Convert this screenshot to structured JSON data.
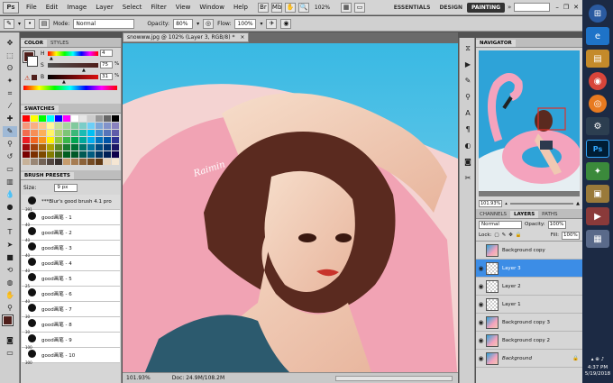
{
  "menubar": {
    "logo": "Ps",
    "items": [
      "File",
      "Edit",
      "Image",
      "Layer",
      "Select",
      "Filter",
      "View",
      "Window",
      "Help"
    ],
    "zoom": "102%",
    "workspaces": [
      "ESSENTIALS",
      "DESIGN",
      "PAINTING"
    ],
    "active_workspace": "PAINTING"
  },
  "options": {
    "mode_label": "Mode:",
    "mode_value": "Normal",
    "opacity_label": "Opacity:",
    "opacity_value": "80%",
    "flow_label": "Flow:",
    "flow_value": "100%"
  },
  "document": {
    "tab_title": "snowww.jpg @ 102% (Layer 3, RGB/8) *",
    "zoom": "101.93%",
    "doc_size": "Doc: 24.9M/108.2M",
    "signature": "Raimin"
  },
  "color_panel": {
    "tabs": [
      "COLOR",
      "STYLES"
    ],
    "h_label": "H",
    "h_value": "4",
    "s_label": "S",
    "s_value": "75",
    "b_label": "B",
    "b_value": "31",
    "fg_color": "#4f1e1a",
    "pct": "%"
  },
  "swatches_panel": {
    "tab": "SWATCHES",
    "colors": [
      "#ff0000",
      "#ffff00",
      "#00ff00",
      "#00ffff",
      "#0000ff",
      "#ff00ff",
      "#ffffff",
      "#e6e6e6",
      "#cccccc",
      "#999999",
      "#666666",
      "#000000",
      "#f7977a",
      "#fbad82",
      "#fdc68c",
      "#fff799",
      "#c6df9c",
      "#a4d49d",
      "#81ca9d",
      "#7bcdc8",
      "#6ccff7",
      "#7ca6d8",
      "#8293ca",
      "#8881be",
      "#f26c4f",
      "#f68e56",
      "#fbaf5a",
      "#fff467",
      "#acd372",
      "#7cc576",
      "#3bb878",
      "#1abbb4",
      "#00bff3",
      "#438ccb",
      "#5574b9",
      "#605ca9",
      "#ed1c24",
      "#f26522",
      "#f7941d",
      "#fff200",
      "#8dc63f",
      "#39b54a",
      "#00a651",
      "#00a99d",
      "#00aeef",
      "#0072bc",
      "#0054a6",
      "#2e3192",
      "#9e0b0f",
      "#a0410d",
      "#a36209",
      "#aba000",
      "#598527",
      "#1a7b30",
      "#007236",
      "#00746b",
      "#0076a3",
      "#004b80",
      "#003471",
      "#1b1464",
      "#790000",
      "#7b2e00",
      "#7d4900",
      "#827b00",
      "#406618",
      "#005e20",
      "#005826",
      "#005952",
      "#005b7f",
      "#003663",
      "#002157",
      "#0d004c",
      "#c7b299",
      "#998675",
      "#736357",
      "#534741",
      "#37302d",
      "#c69c6d",
      "#a67c52",
      "#8c6239",
      "#754c24",
      "#603913",
      "#e8d6c0",
      "#f5e6d3"
    ]
  },
  "brush_presets": {
    "tab": "BRUSH PRESETS",
    "size_label": "Size:",
    "size_value": "9 px",
    "items": [
      {
        "name": "***Blur's good brush 4.1 pro",
        "size": "391"
      },
      {
        "name": "good画笔 - 1",
        "size": "40"
      },
      {
        "name": "good画笔 - 2",
        "size": "40"
      },
      {
        "name": "good画笔 - 3",
        "size": "40"
      },
      {
        "name": "good画笔 - 4",
        "size": "40"
      },
      {
        "name": "good画笔 - 5",
        "size": "25"
      },
      {
        "name": "good画笔 - 6",
        "size": "40"
      },
      {
        "name": "good画笔 - 7",
        "size": "30"
      },
      {
        "name": "good画笔 - 8",
        "size": "30"
      },
      {
        "name": "good画笔 - 9",
        "size": "100"
      },
      {
        "name": "good画笔 - 10",
        "size": "300"
      }
    ]
  },
  "navigator": {
    "tab": "NAVIGATOR"
  },
  "layers_panel": {
    "tabs": [
      "CHANNELS",
      "LAYERS",
      "PATHS"
    ],
    "blend_mode": "Normal",
    "opacity_label": "Opacity:",
    "opacity_value": "100%",
    "lock_label": "Lock:",
    "fill_label": "Fill:",
    "fill_value": "100%",
    "layers": [
      {
        "name": "Background copy",
        "visible": false,
        "selected": false,
        "thumb": "image"
      },
      {
        "name": "Layer 3",
        "visible": true,
        "selected": true,
        "thumb": "empty"
      },
      {
        "name": "Layer 2",
        "visible": true,
        "selected": false,
        "thumb": "empty"
      },
      {
        "name": "Layer 1",
        "visible": true,
        "selected": false,
        "thumb": "empty"
      },
      {
        "name": "Background copy 3",
        "visible": true,
        "selected": false,
        "thumb": "image"
      },
      {
        "name": "Background copy 2",
        "visible": true,
        "selected": false,
        "thumb": "image"
      },
      {
        "name": "Background",
        "visible": true,
        "selected": false,
        "thumb": "image"
      }
    ]
  },
  "taskbar": {
    "time": "4:37 PM",
    "date": "5/19/2018"
  }
}
